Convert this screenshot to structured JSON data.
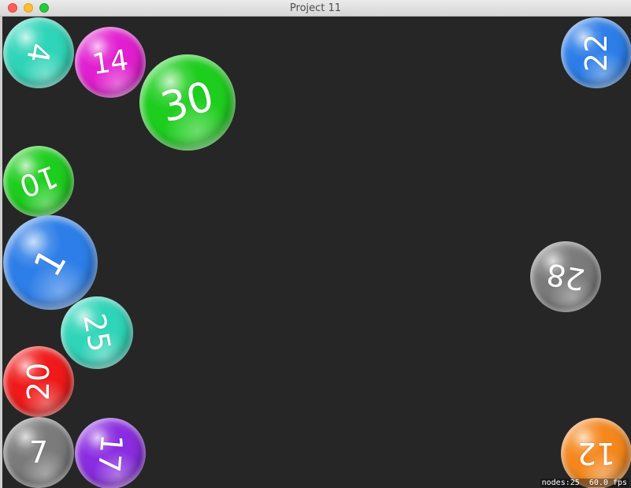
{
  "window": {
    "title": "Project 11"
  },
  "colors": {
    "background": "#262626",
    "teal": "#2fd5b8",
    "magenta": "#e21fd0",
    "green": "#1ece1e",
    "blue": "#2d7ee8",
    "red": "#f01a1a",
    "gray": "#7b7b7b",
    "purple": "#8a2de0",
    "orange": "#f5871d"
  },
  "balls": [
    {
      "number": "4",
      "color": "#2fd5b8"
    },
    {
      "number": "14",
      "color": "#e21fd0"
    },
    {
      "number": "30",
      "color": "#1ece1e"
    },
    {
      "number": "10",
      "color": "#1ece1e"
    },
    {
      "number": "1",
      "color": "#2d7ee8"
    },
    {
      "number": "25",
      "color": "#2fd5b8"
    },
    {
      "number": "20",
      "color": "#f01a1a"
    },
    {
      "number": "7",
      "color": "#7b7b7b"
    },
    {
      "number": "17",
      "color": "#8a2de0"
    },
    {
      "number": "22",
      "color": "#2d7ee8"
    },
    {
      "number": "28",
      "color": "#7b7b7b"
    },
    {
      "number": "12",
      "color": "#f5871d"
    }
  ],
  "stats": {
    "text": "nodes:25  60.0 fps"
  }
}
